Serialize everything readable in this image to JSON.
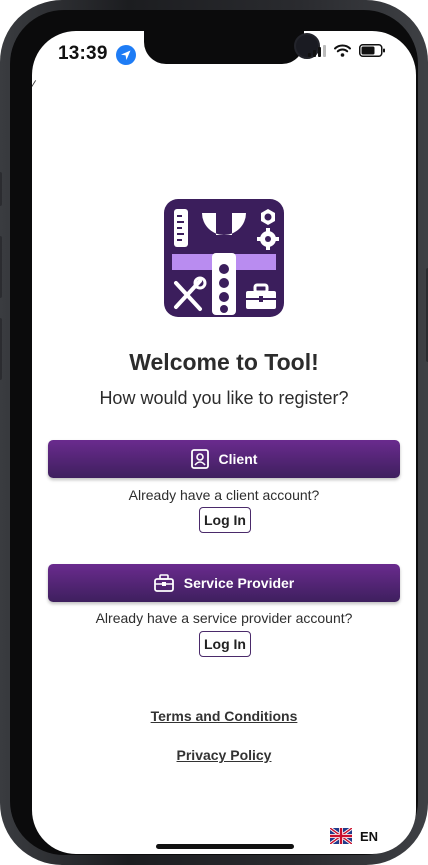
{
  "status_bar": {
    "time": "13:39",
    "icons": [
      "location-arrow-icon",
      "signal-icon",
      "wifi-icon",
      "battery-icon"
    ]
  },
  "welcome": {
    "title": "Welcome to Tool!",
    "subtitle": "How would you like to register?"
  },
  "client": {
    "button_label": "Client",
    "icon": "id-badge-icon",
    "hint": "Already have a client account?",
    "login_label": "Log In"
  },
  "provider": {
    "button_label": "Service Provider",
    "icon": "toolbox-icon",
    "hint": "Already have a service provider account?",
    "login_label": "Log In"
  },
  "links": {
    "terms": "Terms and Conditions",
    "privacy": "Privacy Policy"
  },
  "language": {
    "code": "EN",
    "flag": "uk-flag-icon"
  },
  "colors": {
    "brand_purple": "#3b1e5c",
    "button_gradient_top": "#6a2b8e",
    "button_gradient_bottom": "#3e1f5e",
    "logo_accent": "#b98cf0"
  }
}
